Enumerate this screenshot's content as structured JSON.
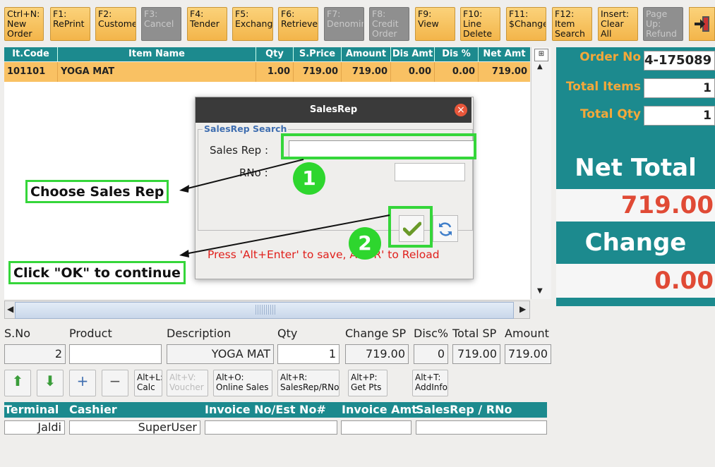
{
  "toolbar": [
    {
      "label": "Ctrl+N:\nNew\nOrder",
      "disabled": false
    },
    {
      "label": "F1:\nRePrint",
      "disabled": false
    },
    {
      "label": "F2:\nCustome",
      "disabled": false
    },
    {
      "label": "F3:\nCancel",
      "disabled": true
    },
    {
      "label": "F4:\nTender",
      "disabled": false
    },
    {
      "label": "F5:\nExchang",
      "disabled": false
    },
    {
      "label": "F6:\nRetrieve",
      "disabled": false
    },
    {
      "label": "F7:\nDenomin",
      "disabled": true
    },
    {
      "label": "F8:\nCredit\nOrder",
      "disabled": true
    },
    {
      "label": "F9:\nView",
      "disabled": false
    },
    {
      "label": "F10:\nLine\nDelete",
      "disabled": false
    },
    {
      "label": "F11:\n$Change",
      "disabled": false
    },
    {
      "label": "F12:\nItem\nSearch",
      "disabled": false
    },
    {
      "label": "Insert:\nClear All",
      "disabled": false
    },
    {
      "label": "Page\nUp:\nRefund",
      "disabled": true
    }
  ],
  "grid": {
    "columns": [
      "It.Code",
      "Item Name",
      "Qty",
      "S.Price",
      "Amount",
      "Dis Amt",
      "Dis %",
      "Net Amt"
    ],
    "rows": [
      [
        "101101",
        "YOGA MAT",
        "1.00",
        "719.00",
        "719.00",
        "0.00",
        "0.00",
        "719.00"
      ]
    ]
  },
  "summary": {
    "order_no_label": "Order No",
    "order_no": "4-175089",
    "total_items_label": "Total Items",
    "total_items": "1",
    "total_qty_label": "Total Qty",
    "total_qty": "1",
    "net_total_label": "Net Total",
    "net_total": "719.00",
    "change_label": "Change",
    "change": "0.00"
  },
  "entry": {
    "labels": {
      "sno": "S.No",
      "product": "Product",
      "description": "Description",
      "qty": "Qty",
      "change_sp": "Change SP",
      "disc": "Disc%",
      "total_sp": "Total SP",
      "amount": "Amount"
    },
    "values": {
      "sno": "2",
      "product": "",
      "description": "YOGA MAT",
      "qty": "1",
      "change_sp": "719.00",
      "disc": "0",
      "total_sp": "719.00",
      "amount": "719.00"
    }
  },
  "shortcuts": {
    "calc": "Alt+L:\nCalc",
    "voucher": "Alt+V:\nVoucher",
    "online_sales": "Alt+O:\nOnline Sales",
    "salesrep": "Alt+R:\nSalesRep/RNo",
    "get_pts": "Alt+P:\nGet Pts",
    "addinfo": "Alt+T:\nAddInfo"
  },
  "status": {
    "labels": {
      "terminal": "Terminal",
      "cashier": "Cashier",
      "invoice": "Invoice No/Est No#",
      "invoice_amt": "Invoice Amt",
      "salesrep": "SalesRep / RNo"
    },
    "values": {
      "terminal": "Jaldi",
      "cashier": "SuperUser",
      "invoice": "",
      "invoice_amt": "",
      "salesrep": ""
    }
  },
  "dialog": {
    "title": "SalesRep",
    "group_title": "SalesRep Search",
    "salesrep_label": "Sales Rep :",
    "salesrep_value": "",
    "rno_label": "RNo :",
    "rno_value": "",
    "hint": "Press 'Alt+Enter' to save, Alt+R' to Reload"
  },
  "annotations": {
    "choose": "Choose Sales Rep",
    "ok": "Click \"OK\" to continue",
    "step1": "1",
    "step2": "2"
  },
  "colors": {
    "teal": "#1c8a8e",
    "orange": "#f4a83a",
    "red": "#e04a35",
    "green": "#35d63a"
  }
}
